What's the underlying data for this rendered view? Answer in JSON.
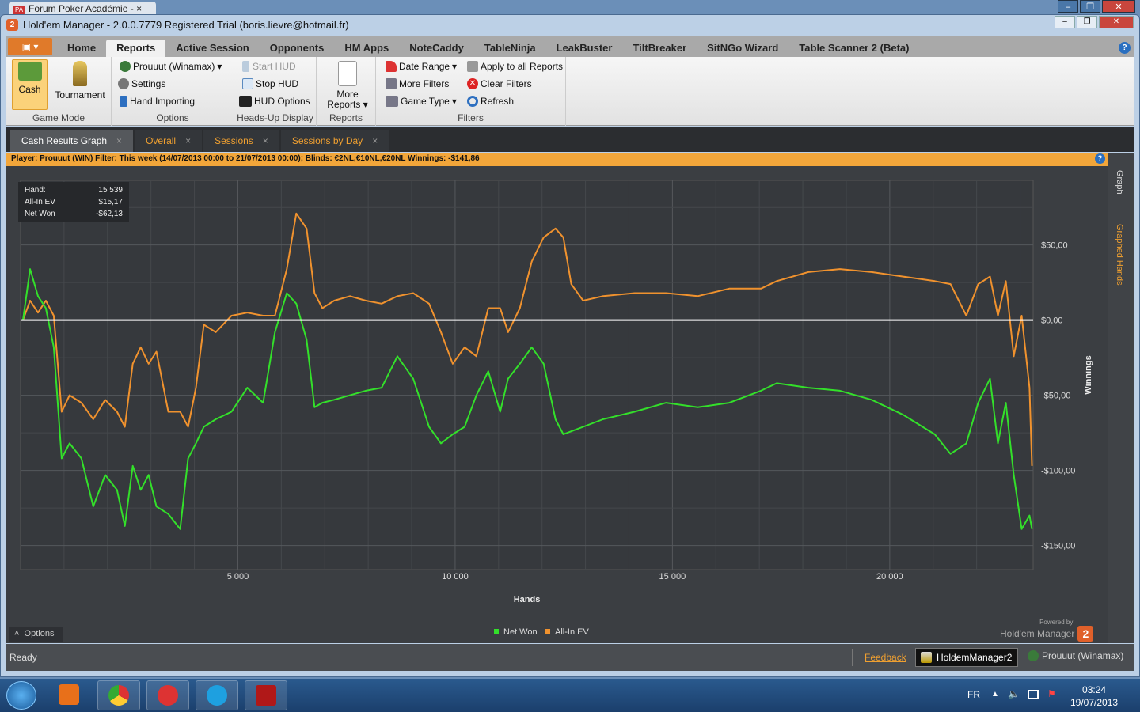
{
  "browser_tab": {
    "title": "Forum Poker Académie -",
    "close": "×"
  },
  "window": {
    "title": "Hold'em Manager - 2.0.0.7779 Registered Trial (boris.lievre@hotmail.fr)",
    "logo": "2"
  },
  "ribbon_tabs": [
    "Home",
    "Reports",
    "Active Session",
    "Opponents",
    "HM Apps",
    "NoteCaddy",
    "TableNinja",
    "LeakBuster",
    "TiltBreaker",
    "SitNGo Wizard",
    "Table Scanner 2 (Beta)"
  ],
  "active_ribbon_tab": "Reports",
  "ribbon": {
    "game_mode": {
      "label": "Game Mode",
      "cash": "Cash",
      "tournament": "Tournament"
    },
    "options": {
      "label": "Options",
      "player": "Prouuut (Winamax)",
      "settings": "Settings",
      "hand_importing": "Hand Importing"
    },
    "hud": {
      "label": "Heads-Up Display",
      "start": "Start HUD",
      "stop": "Stop HUD",
      "options": "HUD Options"
    },
    "reports": {
      "label": "Reports",
      "more1": "More",
      "more2": "Reports"
    },
    "filters": {
      "label": "Filters",
      "date_range": "Date Range",
      "more_filters": "More Filters",
      "game_type": "Game Type",
      "apply_all": "Apply to all Reports",
      "clear": "Clear Filters",
      "refresh": "Refresh"
    }
  },
  "doc_tabs": [
    "Cash Results Graph",
    "Overall",
    "Sessions",
    "Sessions by Day"
  ],
  "filter_bar": "Player:  Prouuut (WIN)  Filter:  This week (14/07/2013 00:00 to 21/07/2013 00:00); Blinds: €2NL,€10NL,€20NL  Winnings:  -$141,86",
  "tooltip": {
    "rows": [
      {
        "k": "Hand:",
        "v": "15 539"
      },
      {
        "k": "All-In EV",
        "v": "$15,17"
      },
      {
        "k": "Net Won",
        "v": "-$62,13"
      }
    ]
  },
  "side_tabs": [
    "Graph",
    "Graphed Hands"
  ],
  "options_label": "Options",
  "powered_by": "Powered by",
  "brand": "Hold'em Manager",
  "status": {
    "ready": "Ready",
    "feedback": "Feedback",
    "db": "HoldemManager2",
    "player": "Prouuut (Winamax)"
  },
  "taskbar": {
    "lang": "FR",
    "time": "03:24",
    "date": "19/07/2013"
  },
  "colors": {
    "net_won": "#33e02a",
    "all_in_ev": "#f0922e",
    "accent": "#f2a63a"
  },
  "chart_data": {
    "type": "line",
    "xlabel": "Hands",
    "ylabel": "Winnings",
    "xlim": [
      0,
      23300
    ],
    "ylim": [
      -166,
      93
    ],
    "xticks": [
      5000,
      10000,
      15000,
      20000
    ],
    "xtick_labels": [
      "5 000",
      "10 000",
      "15 000",
      "20 000"
    ],
    "yticks": [
      50,
      0,
      -50,
      -100,
      -150
    ],
    "ytick_labels": [
      "$50,00",
      "$0,00",
      "-$50,00",
      "-$100,00",
      "-$150,00"
    ],
    "grid": true,
    "legend": "bottom-center",
    "x": [
      55,
      218,
      400,
      582,
      764,
      945,
      1127,
      1400,
      1673,
      1945,
      2218,
      2400,
      2582,
      2764,
      2945,
      3127,
      3400,
      3673,
      3854,
      4036,
      4218,
      4491,
      4854,
      5218,
      5582,
      5854,
      6127,
      6345,
      6582,
      6764,
      6945,
      7218,
      7582,
      7945,
      8309,
      8672,
      9036,
      9400,
      9673,
      9945,
      10218,
      10490,
      10763,
      11036,
      11218,
      11490,
      11763,
      12036,
      12309,
      12490,
      12672,
      12945,
      13400,
      14127,
      14854,
      15581,
      16309,
      17036,
      17400,
      18127,
      18854,
      19581,
      20308,
      21036,
      21399,
      21763,
      22036,
      22308,
      22490,
      22672,
      22854,
      23036,
      23217,
      23272
    ],
    "series": [
      {
        "name": "Net Won",
        "values": [
          0,
          34,
          16,
          8,
          -18,
          -92,
          -82,
          -92,
          -124,
          -103,
          -113,
          -137,
          -97,
          -113,
          -103,
          -124,
          -129,
          -139,
          -92,
          -82,
          -71,
          -66,
          -61,
          -45,
          -55,
          -8,
          18,
          11,
          -13,
          -58,
          -55,
          -53,
          -50,
          -47,
          -45,
          -24,
          -39,
          -71,
          -82,
          -76,
          -71,
          -50,
          -34,
          -61,
          -39,
          -29,
          -18,
          -29,
          -66,
          -76,
          -74,
          -71,
          -66,
          -61,
          -55,
          -58,
          -55,
          -47,
          -42,
          -45,
          -47,
          -53,
          -63,
          -76,
          -89,
          -82,
          -55,
          -39,
          -82,
          -55,
          -103,
          -139,
          -130,
          -139
        ]
      },
      {
        "name": "All-In EV",
        "values": [
          0,
          13,
          5,
          13,
          3,
          -61,
          -50,
          -55,
          -66,
          -53,
          -61,
          -71,
          -29,
          -18,
          -29,
          -21,
          -61,
          -61,
          -71,
          -45,
          -3,
          -8,
          3,
          5,
          3,
          3,
          34,
          71,
          61,
          18,
          8,
          13,
          16,
          13,
          11,
          16,
          18,
          11,
          -8,
          -29,
          -18,
          -24,
          8,
          8,
          -8,
          8,
          39,
          55,
          61,
          55,
          24,
          13,
          16,
          18,
          18,
          16,
          21,
          21,
          26,
          32,
          34,
          32,
          29,
          26,
          24,
          3,
          24,
          29,
          3,
          26,
          -24,
          3,
          -45,
          -97
        ]
      }
    ]
  }
}
